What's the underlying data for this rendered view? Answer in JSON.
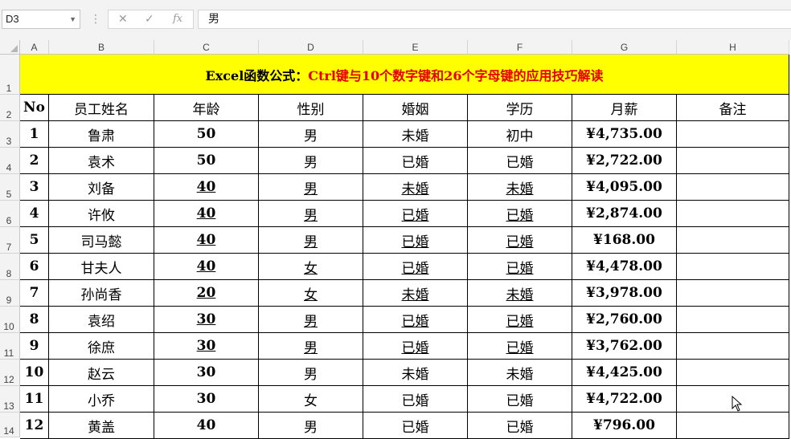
{
  "formula_bar": {
    "name_box": "D3",
    "cancel_icon": "✕",
    "enter_icon": "✓",
    "fx_label": "fx",
    "formula_value": "男"
  },
  "columns": [
    "A",
    "B",
    "C",
    "D",
    "E",
    "F",
    "G",
    "H"
  ],
  "row_numbers": [
    "1",
    "2",
    "3",
    "4",
    "5",
    "6",
    "7",
    "8",
    "9",
    "10",
    "11",
    "12",
    "13",
    "14"
  ],
  "title": {
    "part1": "Excel函数公式：",
    "part2": "Ctrl键与10个数字键和26个字母键的应用技巧解读"
  },
  "headers": [
    "No",
    "员工姓名",
    "年龄",
    "性别",
    "婚姻",
    "学历",
    "月薪",
    "备注"
  ],
  "rows": [
    {
      "no": "1",
      "name": "鲁肃",
      "age": "50",
      "gender": "男",
      "marriage": "未婚",
      "edu": "初中",
      "salary": "¥4,735.00",
      "note": "",
      "underline": false
    },
    {
      "no": "2",
      "name": "袁术",
      "age": "50",
      "gender": "男",
      "marriage": "已婚",
      "edu": "已婚",
      "salary": "¥2,722.00",
      "note": "",
      "underline": false
    },
    {
      "no": "3",
      "name": "刘备",
      "age": "40",
      "gender": "男",
      "marriage": "未婚",
      "edu": "未婚",
      "salary": "¥4,095.00",
      "note": "",
      "underline": true
    },
    {
      "no": "4",
      "name": "许攸",
      "age": "40",
      "gender": "男",
      "marriage": "已婚",
      "edu": "已婚",
      "salary": "¥2,874.00",
      "note": "",
      "underline": true
    },
    {
      "no": "5",
      "name": "司马懿",
      "age": "40",
      "gender": "男",
      "marriage": "已婚",
      "edu": "已婚",
      "salary": "¥168.00",
      "note": "",
      "underline": true
    },
    {
      "no": "6",
      "name": "甘夫人",
      "age": "40",
      "gender": "女",
      "marriage": "已婚",
      "edu": "已婚",
      "salary": "¥4,478.00",
      "note": "",
      "underline": true
    },
    {
      "no": "7",
      "name": "孙尚香",
      "age": "20",
      "gender": "女",
      "marriage": "未婚",
      "edu": "未婚",
      "salary": "¥3,978.00",
      "note": "",
      "underline": true
    },
    {
      "no": "8",
      "name": "袁绍",
      "age": "30",
      "gender": "男",
      "marriage": "已婚",
      "edu": "已婚",
      "salary": "¥2,760.00",
      "note": "",
      "underline": true
    },
    {
      "no": "9",
      "name": "徐庶",
      "age": "30",
      "gender": "男",
      "marriage": "已婚",
      "edu": "已婚",
      "salary": "¥3,762.00",
      "note": "",
      "underline": true
    },
    {
      "no": "10",
      "name": "赵云",
      "age": "30",
      "gender": "男",
      "marriage": "未婚",
      "edu": "未婚",
      "salary": "¥4,425.00",
      "note": "",
      "underline": false
    },
    {
      "no": "11",
      "name": "小乔",
      "age": "30",
      "gender": "女",
      "marriage": "已婚",
      "edu": "已婚",
      "salary": "¥4,722.00",
      "note": "",
      "underline": false
    },
    {
      "no": "12",
      "name": "黄盖",
      "age": "40",
      "gender": "男",
      "marriage": "已婚",
      "edu": "已婚",
      "salary": "¥796.00",
      "note": "",
      "underline": false
    }
  ],
  "colors": {
    "title_bg": "#ffff00",
    "title_accent": "#e60000"
  }
}
